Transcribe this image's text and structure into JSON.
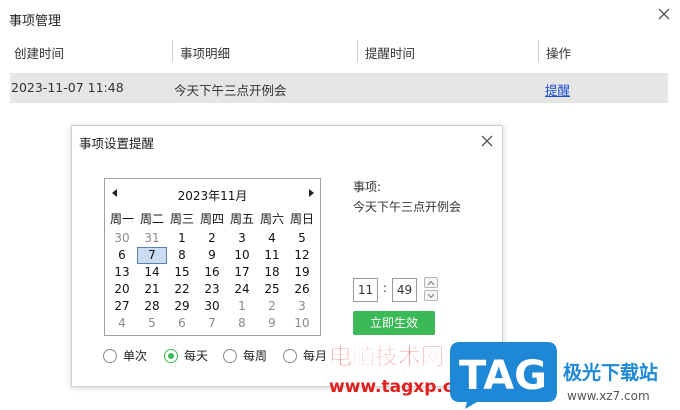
{
  "window": {
    "title": "事项管理"
  },
  "table": {
    "headers": [
      "创建时间",
      "事项明细",
      "提醒时间",
      "操作"
    ],
    "rows": [
      {
        "created": "2023-11-07 11:48",
        "detail": "今天下午三点开例会",
        "remind": "",
        "action": "提醒"
      }
    ]
  },
  "dialog": {
    "title": "事项设置提醒",
    "calendar": {
      "month_label": "2023年11月",
      "weekdays": [
        "周一",
        "周二",
        "周三",
        "周四",
        "周五",
        "周六",
        "周日"
      ],
      "days": [
        [
          "30",
          "31",
          "1",
          "2",
          "3",
          "4",
          "5"
        ],
        [
          "6",
          "7",
          "8",
          "9",
          "10",
          "11",
          "12"
        ],
        [
          "13",
          "14",
          "15",
          "16",
          "17",
          "18",
          "19"
        ],
        [
          "20",
          "21",
          "22",
          "23",
          "24",
          "25",
          "26"
        ],
        [
          "27",
          "28",
          "29",
          "30",
          "1",
          "2",
          "3"
        ],
        [
          "4",
          "5",
          "6",
          "7",
          "8",
          "9",
          "10"
        ]
      ],
      "selected_day": "7"
    },
    "item_label": "事项:",
    "item_value": "今天下午三点开例会",
    "hour": "11",
    "minute": "49",
    "apply_label": "立即生效",
    "repeat_options": [
      "单次",
      "每天",
      "每周",
      "每月"
    ],
    "repeat_selected": "每天"
  },
  "watermark": {
    "cn_text": "电脑技术网",
    "url_text": "www.tagxp.com",
    "tag_text": "TAG",
    "site_text": "极光下载站",
    "site_url": "www.xz7.com"
  },
  "colors": {
    "accent_green": "#3cb957",
    "link_blue": "#1a4fd6",
    "row_bg": "#e6e6e6",
    "watermark_red": "#e0201e",
    "watermark_blue": "#1e88d6"
  }
}
